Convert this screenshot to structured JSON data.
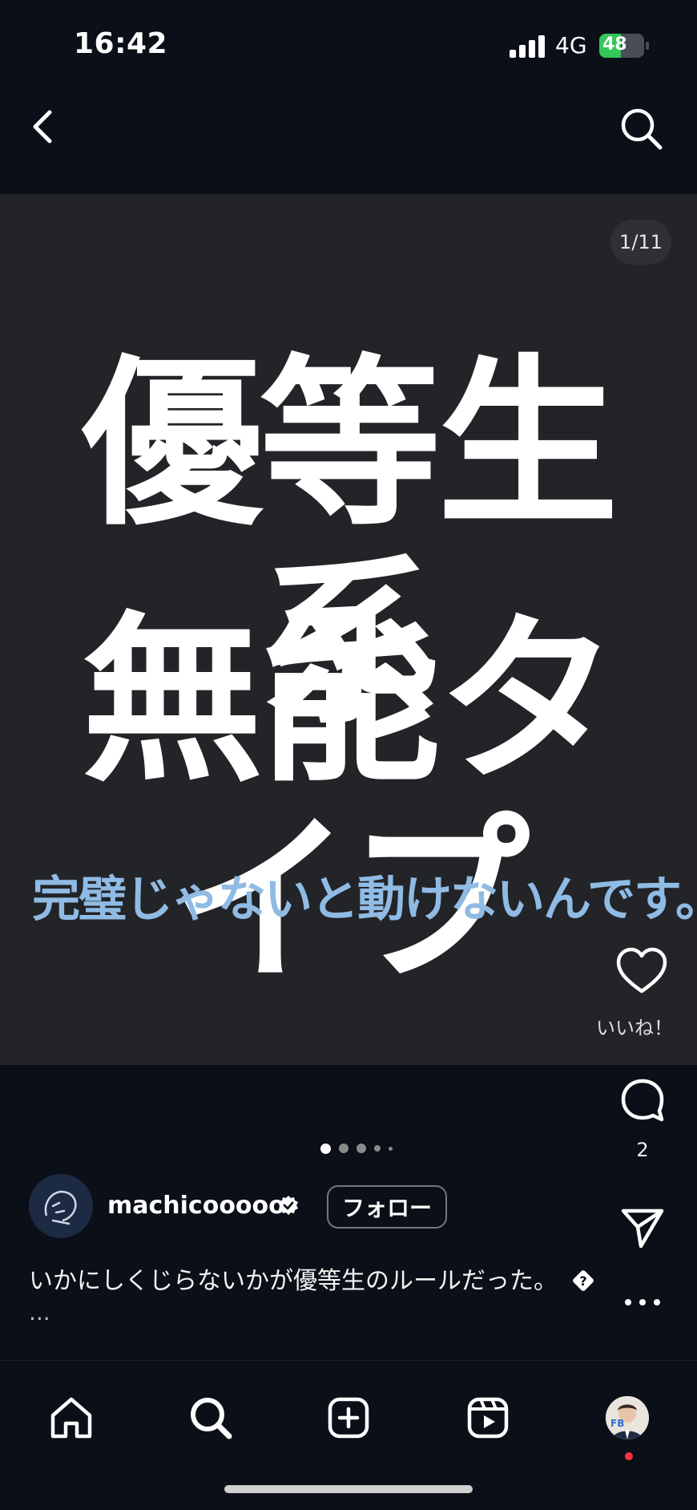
{
  "status_bar": {
    "time": "16:42",
    "network": "4G",
    "battery_percent": "48",
    "battery_level": 0.48,
    "battery_color": "#34c759"
  },
  "header": {
    "back_icon": "chevron-left-icon",
    "search_icon": "search-icon"
  },
  "post": {
    "slide_counter": "1/11",
    "title_line_1": "優等生系",
    "title_line_2": "無能タイプ",
    "subtitle": "完璧じゃないと動けないんです。",
    "subtitle_color": "#8fbbe4",
    "background_color": "#232428"
  },
  "actions": {
    "like_label": "いいね！",
    "comment_count": "2"
  },
  "carousel": {
    "active_index": 0,
    "total_dots": 5
  },
  "account": {
    "username": "machicooooo",
    "verified": true,
    "follow_label": "フォロー"
  },
  "caption": {
    "text": "いかにしくじらないかが優等生のルールだった。",
    "more": "..."
  },
  "bottom_nav": {
    "items": [
      "home-icon",
      "search-icon",
      "create-icon",
      "reels-icon",
      "profile-avatar"
    ],
    "notification_color": "#ff3040"
  }
}
